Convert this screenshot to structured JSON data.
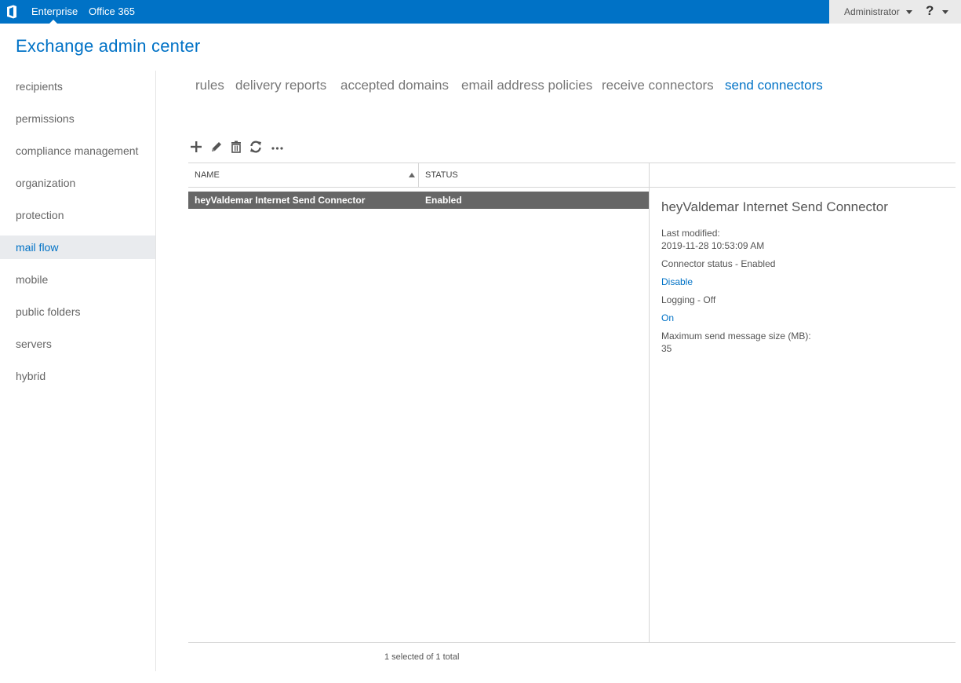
{
  "topbar": {
    "logo_icon": "office-logo-icon",
    "links": [
      "Enterprise",
      "Office 365"
    ],
    "user": "Administrator",
    "help_label": "?"
  },
  "app_title": "Exchange admin center",
  "sidebar": {
    "items": [
      {
        "label": "recipients",
        "active": false
      },
      {
        "label": "permissions",
        "active": false
      },
      {
        "label": "compliance management",
        "active": false
      },
      {
        "label": "organization",
        "active": false
      },
      {
        "label": "protection",
        "active": false
      },
      {
        "label": "mail flow",
        "active": true
      },
      {
        "label": "mobile",
        "active": false
      },
      {
        "label": "public folders",
        "active": false
      },
      {
        "label": "servers",
        "active": false
      },
      {
        "label": "hybrid",
        "active": false
      }
    ]
  },
  "tabs": [
    {
      "label": "rules",
      "active": false
    },
    {
      "label": "delivery reports",
      "active": false
    },
    {
      "label": "accepted domains",
      "active": false
    },
    {
      "label": "email address policies",
      "active": false
    },
    {
      "label": "receive connectors",
      "active": false
    },
    {
      "label": "send connectors",
      "active": true
    }
  ],
  "toolbar": {
    "icons": [
      "add-icon",
      "edit-icon",
      "delete-icon",
      "refresh-icon",
      "more-icon"
    ]
  },
  "list": {
    "columns": [
      "NAME",
      "STATUS"
    ],
    "sort": {
      "column": "NAME",
      "direction": "ascending"
    },
    "rows": [
      {
        "name": "heyValdemar Internet Send Connector",
        "status": "Enabled",
        "selected": true
      }
    ],
    "footer": "1 selected of 1 total"
  },
  "details": {
    "title": "heyValdemar Internet Send Connector",
    "last_modified_label": "Last modified:",
    "last_modified_value": "2019-11-28 10:53:09 AM",
    "connector_status": "Connector status - Enabled",
    "connector_action": "Disable",
    "logging_status": "Logging - Off",
    "logging_action": "On",
    "max_size_label": "Maximum send message size (MB):",
    "max_size_value": "35"
  },
  "colors": {
    "accent": "#0072c6",
    "selected_row": "#666666"
  }
}
